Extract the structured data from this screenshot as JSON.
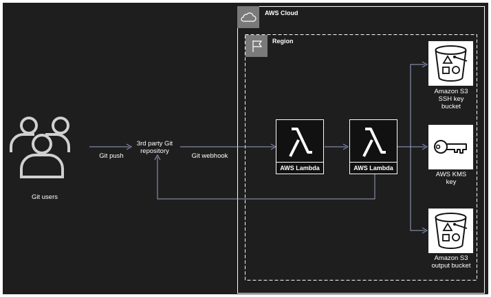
{
  "groups": {
    "cloud_label": "AWS Cloud",
    "region_label": "Region"
  },
  "nodes": {
    "git_users": "Git users",
    "repo_line1": "3rd party Git",
    "repo_line2": "repository",
    "lambda1": "AWS Lambda",
    "lambda2": "AWS Lambda",
    "s3_ssh_line1": "Amazon S3",
    "s3_ssh_line2": "SSH key",
    "s3_ssh_line3": "bucket",
    "kms_line1": "AWS KMS",
    "kms_line2": "key",
    "s3_out_line1": "Amazon S3",
    "s3_out_line2": "output bucket"
  },
  "edges": {
    "git_push": "Git push",
    "git_webhook": "Git webhook"
  },
  "icons": {
    "cloud": "cloud-icon",
    "region": "flag-icon",
    "users": "users-icon",
    "lambda": "lambda-icon",
    "s3": "bucket-icon",
    "kms": "key-icon"
  },
  "colors": {
    "background": "#1e1e1e",
    "line": "#ffffff",
    "arrow": "#9aa3c7",
    "group_box": "#ffffff"
  }
}
